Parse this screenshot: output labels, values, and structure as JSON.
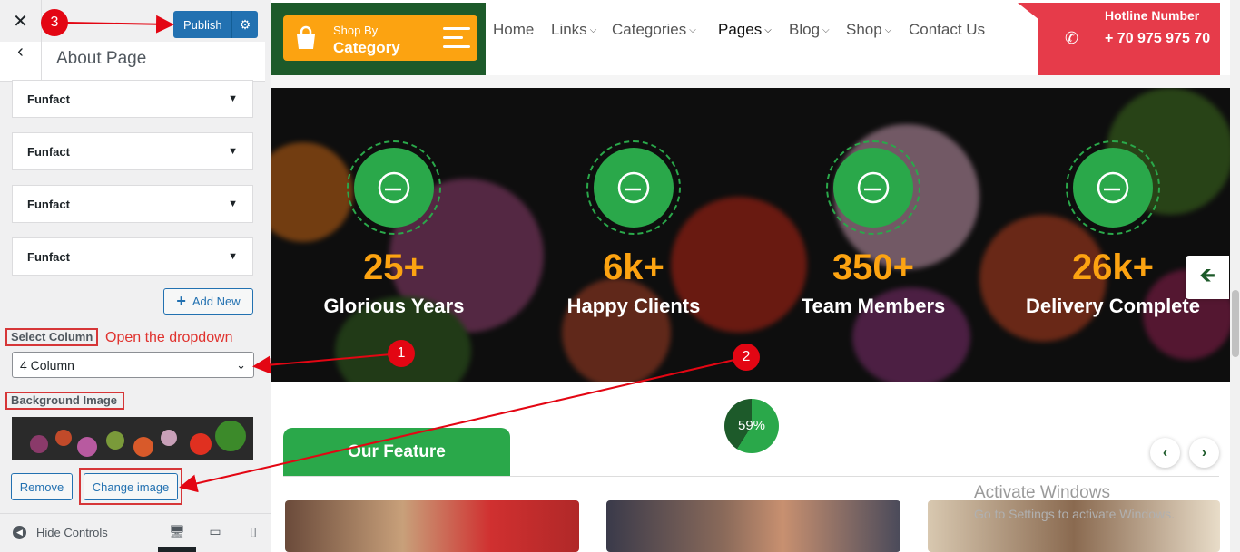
{
  "customizer": {
    "close_icon": "close-icon",
    "publish_label": "Publish",
    "settings_icon": "gear-icon",
    "back_icon": "chevron-left-icon",
    "section_title": "About Page",
    "funfact_items": [
      "Funfact",
      "Funfact",
      "Funfact",
      "Funfact"
    ],
    "add_new_label": "Add New",
    "select_column_label": "Select Column",
    "select_column_value": "4 Column",
    "background_image_label": "Background Image",
    "remove_label": "Remove",
    "change_image_label": "Change image",
    "hide_controls_label": "Hide Controls",
    "devices": [
      "desktop",
      "tablet",
      "mobile"
    ]
  },
  "annotations": {
    "hint": "Open the dropdown",
    "badges": [
      "1",
      "2",
      "3"
    ],
    "color": "#e30613"
  },
  "site": {
    "shop_by": "Shop By",
    "category": "Category",
    "nav": [
      {
        "label": "Home",
        "dropdown": false
      },
      {
        "label": "Links",
        "dropdown": true
      },
      {
        "label": "Categories",
        "dropdown": true
      },
      {
        "label": "Pages",
        "dropdown": true
      },
      {
        "label": "Blog",
        "dropdown": true
      },
      {
        "label": "Shop",
        "dropdown": true
      },
      {
        "label": "Contact Us",
        "dropdown": false
      }
    ],
    "hotline_title": "Hotline Number",
    "hotline_number": "+ 70 975 975 70",
    "funfacts": [
      {
        "number": "25+",
        "title": "Glorious Years"
      },
      {
        "number": "6k+",
        "title": "Happy Clients"
      },
      {
        "number": "350+",
        "title": "Team Members"
      },
      {
        "number": "26k+",
        "title": "Delivery Complete"
      }
    ],
    "progress_percent": "59%",
    "progress_value": 0.59,
    "feature_title": "Our Feature",
    "colors": {
      "green": "#2aa84a",
      "dark_green": "#1d5a2a",
      "orange": "#fca311",
      "red": "#e63b4a"
    }
  },
  "watermark": {
    "line1": "Activate Windows",
    "line2": "Go to Settings to activate Windows."
  }
}
